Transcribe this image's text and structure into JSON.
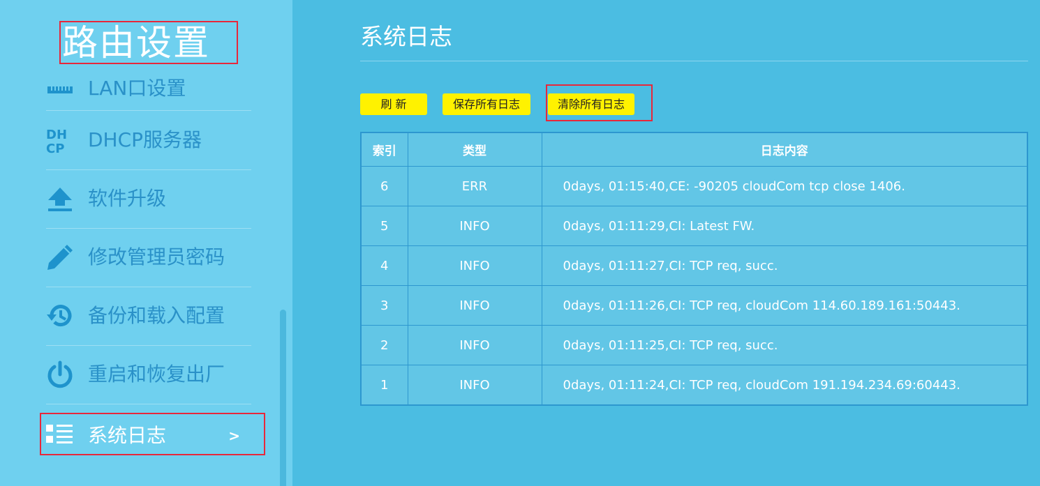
{
  "sidebar": {
    "title": "路由设置",
    "items": [
      {
        "label": "LAN口设置",
        "icon": "lan-port-icon"
      },
      {
        "label": "DHCP服务器",
        "icon": "dhcp-icon"
      },
      {
        "label": "软件升级",
        "icon": "upload-icon"
      },
      {
        "label": "修改管理员密码",
        "icon": "pencil-icon"
      },
      {
        "label": "备份和载入配置",
        "icon": "history-icon"
      },
      {
        "label": "重启和恢复出厂",
        "icon": "power-icon"
      },
      {
        "label": "系统日志",
        "icon": "log-list-icon",
        "active": true,
        "chevron": ">"
      }
    ]
  },
  "main": {
    "title": "系统日志",
    "buttons": {
      "refresh": "刷 新",
      "save_all": "保存所有日志",
      "clear_all": "清除所有日志"
    },
    "table": {
      "headers": [
        "索引",
        "类型",
        "日志内容"
      ],
      "rows": [
        [
          "6",
          "ERR",
          "0days, 01:15:40,CE: -90205 cloudCom tcp close 1406."
        ],
        [
          "5",
          "INFO",
          "0days, 01:11:29,CI: Latest FW."
        ],
        [
          "4",
          "INFO",
          "0days, 01:11:27,CI: TCP req, succ."
        ],
        [
          "3",
          "INFO",
          "0days, 01:11:26,CI: TCP req, cloudCom 114.60.189.161:50443."
        ],
        [
          "2",
          "INFO",
          "0days, 01:11:25,CI: TCP req, succ."
        ],
        [
          "1",
          "INFO",
          "0days, 01:11:24,CI: TCP req, cloudCom 191.194.234.69:60443."
        ]
      ]
    }
  },
  "colors": {
    "sidebar_bg": "#6fd0ef",
    "main_bg": "#4bbde2",
    "button_bg": "#fff200",
    "highlight_border": "#e8273a"
  }
}
